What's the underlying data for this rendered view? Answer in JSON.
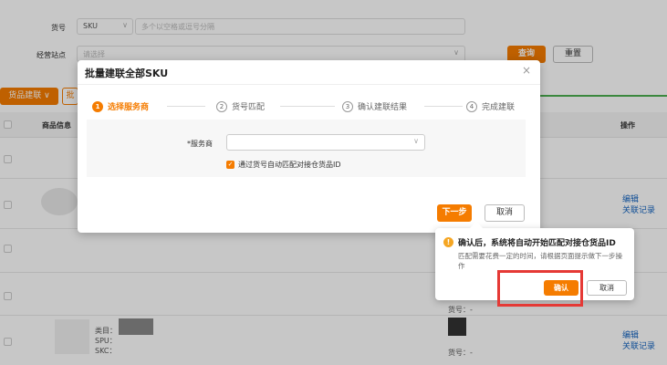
{
  "filters": {
    "sku_label": "货号",
    "sku_select": "SKU",
    "sku_placeholder": "多个以空格或逗号分隔",
    "site_label": "经营站点",
    "site_placeholder": "请选择",
    "query_button": "查询",
    "reset_button": "重置"
  },
  "toolbar": {
    "link_dropdown": "货品建联",
    "link_dropdown_caret": "∨",
    "batch_button_partial": "批"
  },
  "table": {
    "headers": {
      "product_info": "商品信息",
      "actions": "操作"
    },
    "rows": [
      {
        "actions": [
          "编辑",
          "关联记录"
        ]
      },
      {
        "category": "类目：",
        "spu": "SPU：",
        "skc": "SKC：",
        "sku_no": "货号：-",
        "actions": [
          "编辑",
          "关联记录"
        ]
      }
    ],
    "mid_sku_no": "货号：-"
  },
  "modal": {
    "title": "批量建联全部SKU",
    "close_icon": "×",
    "steps": [
      {
        "num": "1",
        "label": "选择服务商"
      },
      {
        "num": "2",
        "label": "货号匹配"
      },
      {
        "num": "3",
        "label": "确认建联结果"
      },
      {
        "num": "4",
        "label": "完成建联"
      }
    ],
    "provider_label": "*服务商",
    "auto_match_checkbox": "通过货号自动匹配对接仓货品ID",
    "next_button": "下一步",
    "cancel_button": "取消"
  },
  "popover": {
    "title": "确认后，系统将自动开始匹配对接仓货品ID",
    "body": "匹配需要花费一定的时间，请根据页面提示做下一步操作",
    "confirm_button": "确认",
    "cancel_button": "取消"
  },
  "colors": {
    "accent": "#f57c00",
    "highlight": "#e53935",
    "link": "#1565c0"
  }
}
